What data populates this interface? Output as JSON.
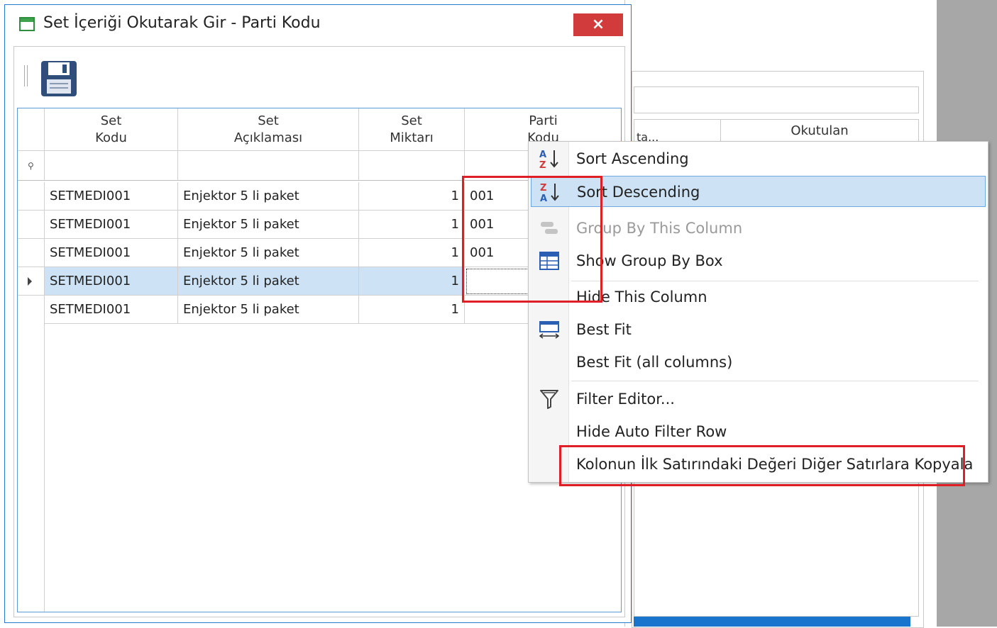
{
  "background_window": {
    "grid_header": "Okutulan",
    "header_fragment": "ta..."
  },
  "dialog": {
    "title": "Set İçeriği Okutarak Gir - Parti Kodu",
    "close_label": "×",
    "toolbar": {
      "save_icon": "save-icon"
    }
  },
  "grid": {
    "columns": [
      {
        "line1": "Set",
        "line2": "Kodu"
      },
      {
        "line1": "Set",
        "line2": "Açıklaması"
      },
      {
        "line1": "Set",
        "line2": "Miktarı"
      },
      {
        "line1": "Parti",
        "line2": "Kodu"
      }
    ],
    "rows": [
      {
        "set_kodu": "SETMEDI001",
        "aciklama": "Enjektor 5 li paket",
        "miktar": "1",
        "parti": "001"
      },
      {
        "set_kodu": "SETMEDI001",
        "aciklama": "Enjektor 5 li paket",
        "miktar": "1",
        "parti": "001"
      },
      {
        "set_kodu": "SETMEDI001",
        "aciklama": "Enjektor 5 li paket",
        "miktar": "1",
        "parti": "001"
      },
      {
        "set_kodu": "SETMEDI001",
        "aciklama": "Enjektor 5 li paket",
        "miktar": "1",
        "parti": ""
      },
      {
        "set_kodu": "SETMEDI001",
        "aciklama": "Enjektor 5 li paket",
        "miktar": "1",
        "parti": ""
      }
    ],
    "selected_row_index": 3
  },
  "context_menu": {
    "items": [
      {
        "label": "Sort Ascending",
        "icon": "sort-ascending-icon",
        "enabled": true
      },
      {
        "label": "Sort Descending",
        "icon": "sort-descending-icon",
        "enabled": true,
        "highlighted": true
      },
      {
        "label": "Group By This Column",
        "icon": "group-by-icon",
        "enabled": false
      },
      {
        "label": "Show Group By Box",
        "icon": "group-box-icon",
        "enabled": true
      },
      {
        "label": "Hide This Column",
        "icon": "",
        "enabled": true
      },
      {
        "label": "Best Fit",
        "icon": "best-fit-icon",
        "enabled": true
      },
      {
        "label": "Best Fit (all columns)",
        "icon": "",
        "enabled": true
      },
      {
        "label": "Filter Editor...",
        "icon": "filter-icon",
        "enabled": true
      },
      {
        "label": "Hide Auto Filter Row",
        "icon": "",
        "enabled": true
      },
      {
        "label": "Kolonun İlk Satırındaki Değeri Diğer Satırlara Kopyala",
        "icon": "",
        "enabled": true
      }
    ]
  },
  "colors": {
    "selection": "#cde3f5",
    "highlight_border": "#e01e26",
    "close_button": "#d13b3b",
    "dialog_border": "#2b79d0"
  }
}
